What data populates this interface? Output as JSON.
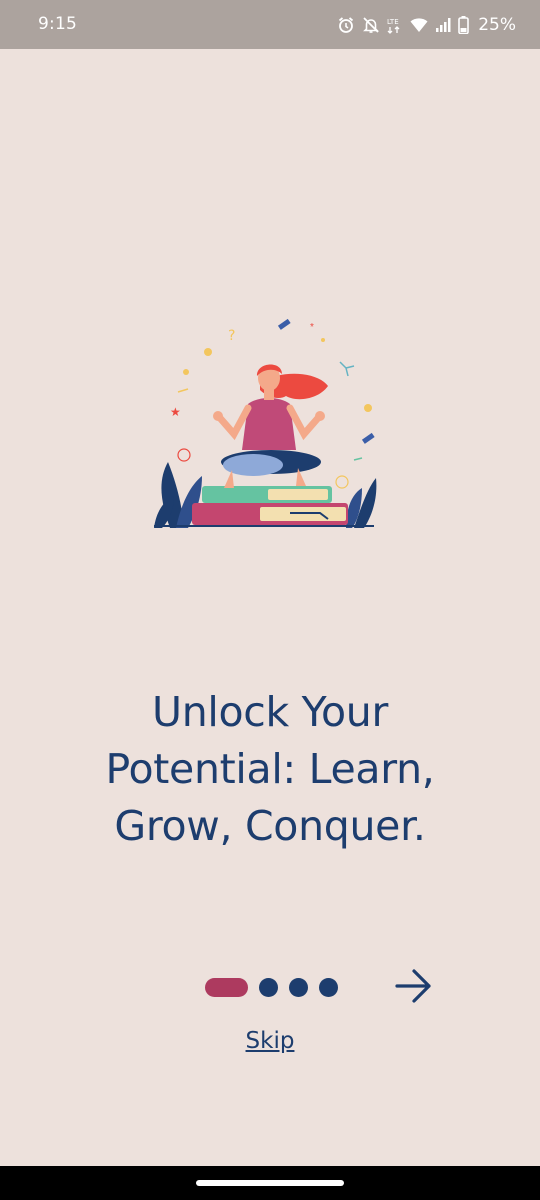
{
  "status_bar": {
    "time": "9:15",
    "battery": "25%",
    "icons": [
      "alarm-icon",
      "notifications-off-icon",
      "lte-icon",
      "wifi-icon",
      "signal-icon",
      "battery-icon"
    ]
  },
  "onboarding": {
    "headline": "Unlock Your Potential: Learn, Grow, Conquer.",
    "skip_label": "Skip",
    "page_indicator": {
      "current": 1,
      "total": 4
    },
    "next_icon": "arrow-right-icon",
    "illustration": "meditating-woman-on-books-illustration"
  },
  "colors": {
    "background": "#ede1dc",
    "status_bar": "#aca39e",
    "primary": "#1d3d6e",
    "accent": "#ad3a5f"
  }
}
